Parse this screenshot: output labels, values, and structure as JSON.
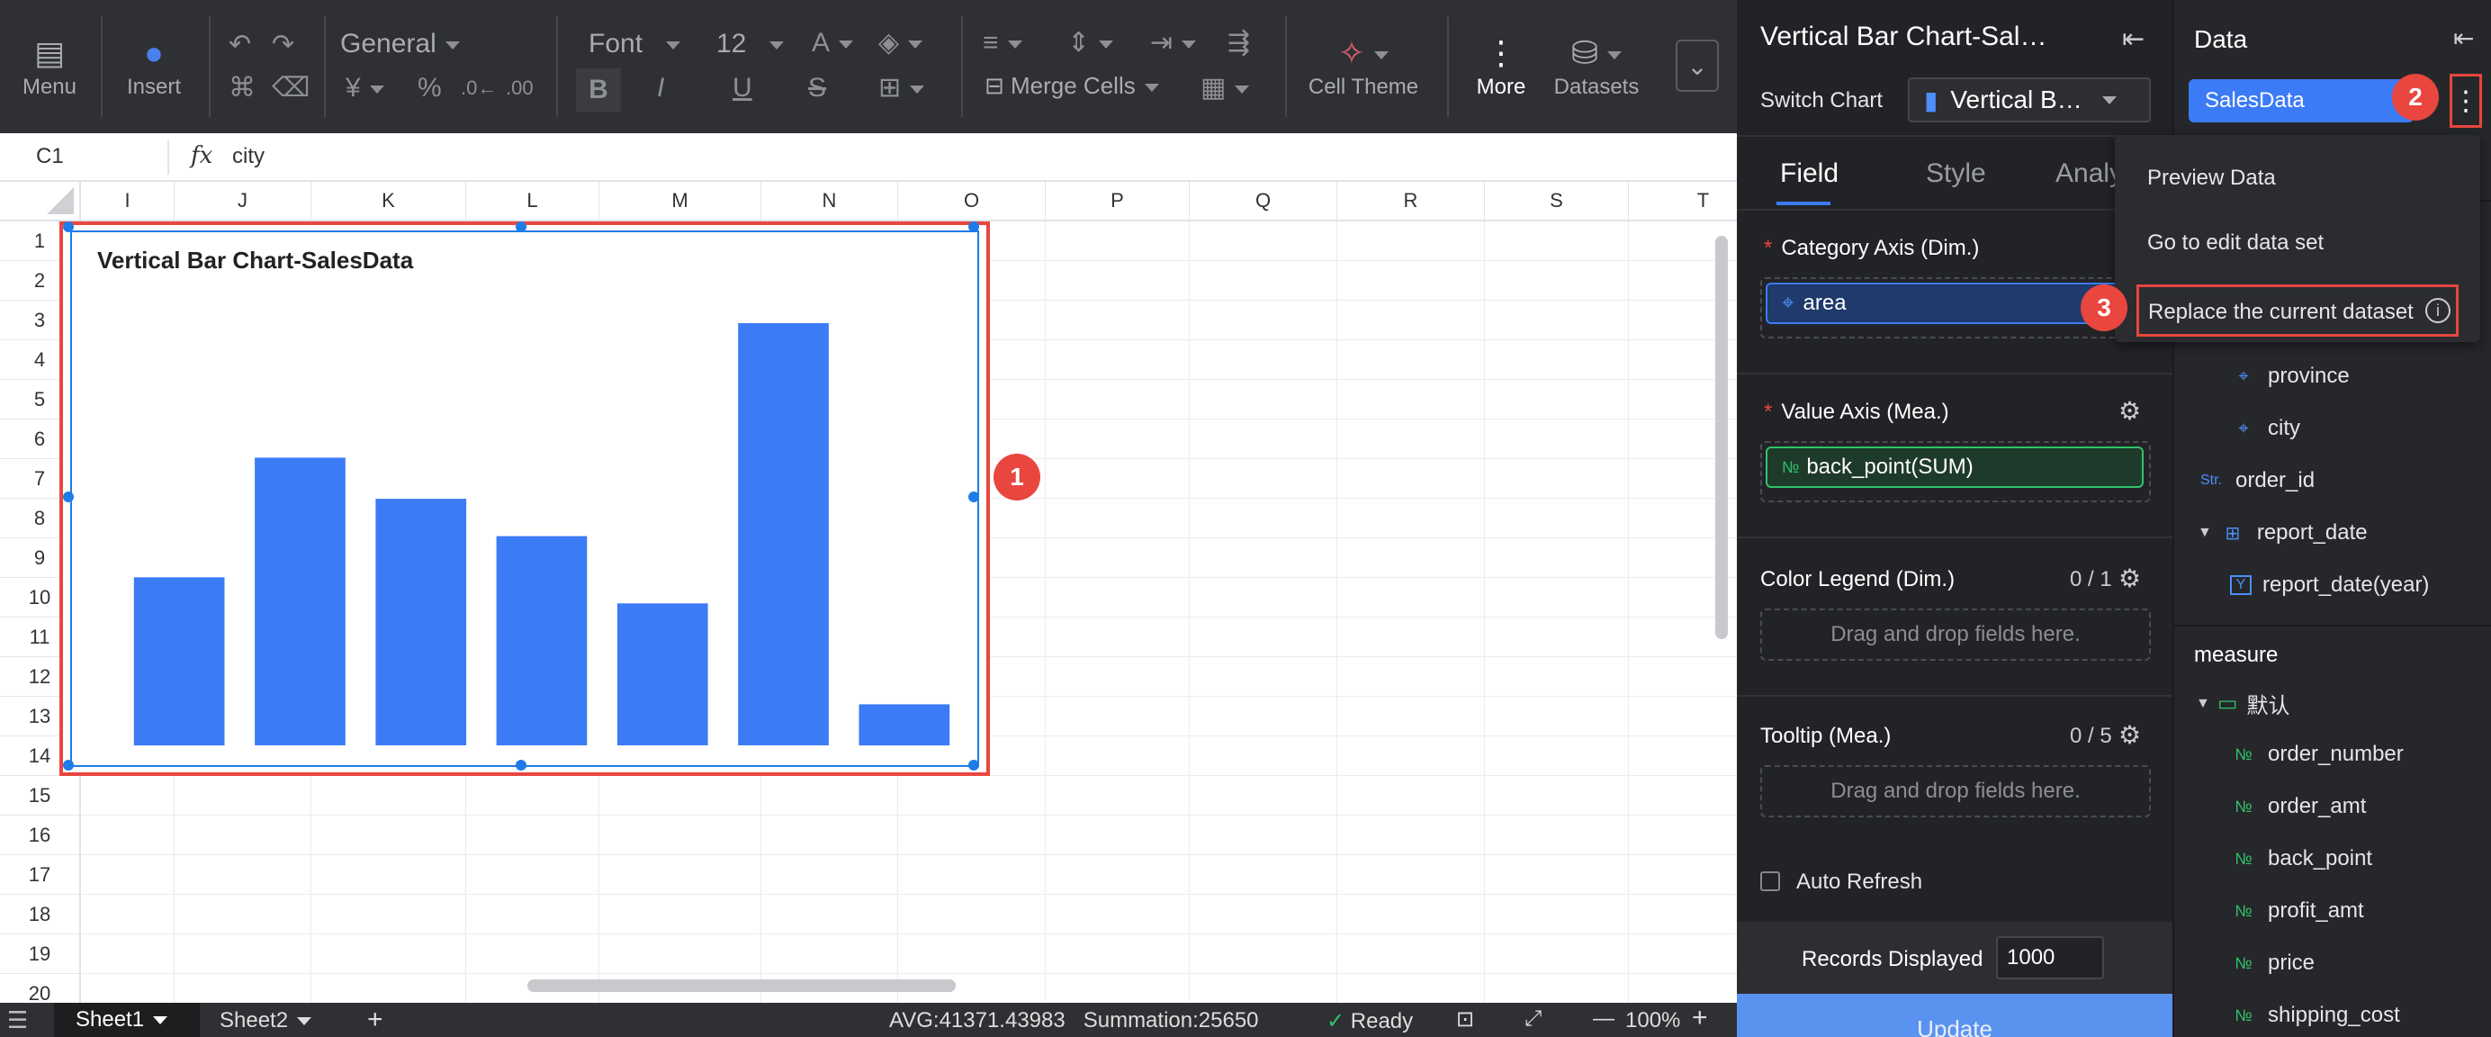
{
  "toolbar": {
    "menu": "Menu",
    "insert": "Insert",
    "number_format": "General",
    "font": "Font",
    "font_size": "12",
    "merge_cells": "Merge Cells",
    "cell_theme": "Cell Theme",
    "more": "More",
    "datasets": "Datasets"
  },
  "formula_bar": {
    "cell_ref": "C1",
    "fx": "fx",
    "value": "city"
  },
  "sheet": {
    "columns": [
      "I",
      "J",
      "K",
      "L",
      "M",
      "N",
      "O",
      "P",
      "Q",
      "R",
      "S",
      "T"
    ],
    "rows": [
      "1",
      "2",
      "3",
      "4",
      "5",
      "6",
      "7",
      "8",
      "9",
      "10",
      "11",
      "12",
      "13",
      "14",
      "15",
      "16",
      "17",
      "18",
      "19",
      "20"
    ]
  },
  "chart_data": {
    "type": "bar",
    "title": "Vertical Bar Chart-SalesData",
    "categories": [
      "",
      "",
      "",
      "",
      "",
      "",
      ""
    ],
    "values": [
      4.5,
      7.7,
      6.6,
      5.6,
      3.8,
      11.3,
      1.1
    ],
    "ylim": [
      0,
      12
    ],
    "grid": false,
    "color": "#3c7bf6"
  },
  "status_bar": {
    "tabs": [
      "Sheet1",
      "Sheet2"
    ],
    "add": "+",
    "stats": "AVG:41371.43983   Summation:25650",
    "ready": "Ready",
    "zoom": "100%",
    "minus": "—",
    "plus": "+"
  },
  "config_panel": {
    "title": "Vertical Bar Chart-Sal…",
    "switch_chart_label": "Switch Chart",
    "chart_type": "Vertical B…",
    "tabs": [
      "Field",
      "Style",
      "Analy"
    ],
    "category_axis": {
      "label": "Category Axis (Dim.)",
      "field": "area"
    },
    "value_axis": {
      "label": "Value Axis (Mea.)",
      "field": "back_point(SUM)"
    },
    "color_legend": {
      "label": "Color Legend (Dim.)",
      "count": "0 / 1",
      "placeholder": "Drag and drop fields here."
    },
    "tooltip": {
      "label": "Tooltip (Mea.)",
      "count": "0 / 5",
      "placeholder": "Drag and drop fields here."
    },
    "auto_refresh": "Auto Refresh",
    "records_label": "Records Displayed",
    "records_value": "1000",
    "update": "Update",
    "required_mark": "*"
  },
  "data_panel": {
    "title": "Data",
    "dataset": "SalesData",
    "dimension_fields": [
      {
        "name": "province",
        "icon": "geo",
        "indent": 2
      },
      {
        "name": "city",
        "icon": "geo",
        "indent": 2
      },
      {
        "name": "order_id",
        "icon": "Str.",
        "indent": 1
      },
      {
        "name": "report_date",
        "icon": "hierarchy",
        "indent": 1,
        "expand": true
      },
      {
        "name": "report_date(year)",
        "icon": "Y",
        "indent": 2
      }
    ],
    "measure_label": "measure",
    "measure_folder": "默认",
    "measure_fields": [
      "order_number",
      "order_amt",
      "back_point",
      "profit_amt",
      "price",
      "shipping_cost"
    ],
    "measure_icon": "№"
  },
  "context_menu": {
    "items": [
      "Preview Data",
      "Go to edit data set",
      "Replace the current dataset"
    ]
  },
  "annotations": [
    "1",
    "2",
    "3"
  ],
  "colors": {
    "accent": "#3c7bf6",
    "highlight": "#e8463e",
    "measure_green": "#31c26a",
    "toolbar_bg": "#2f3033",
    "panel_bg": "#222326"
  }
}
